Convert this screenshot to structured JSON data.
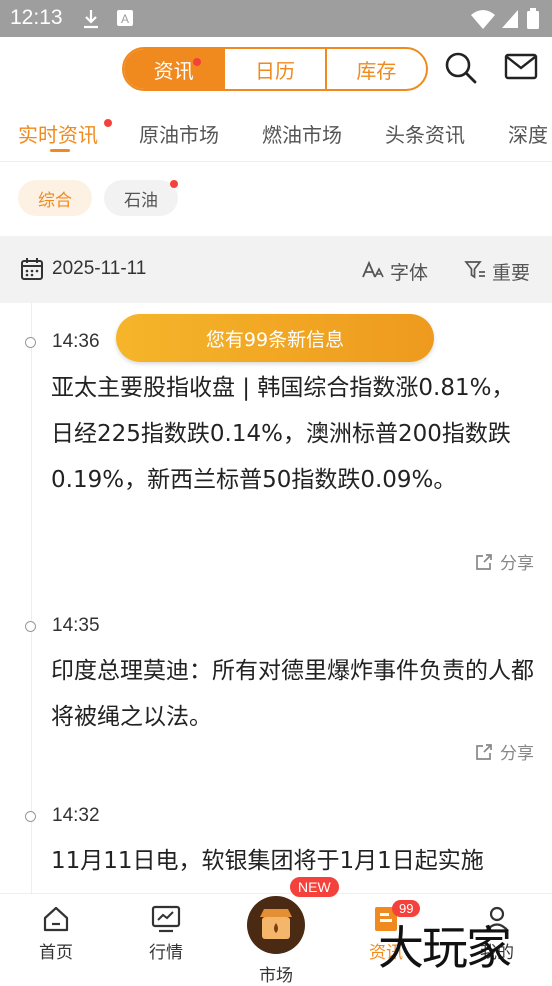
{
  "status_bar": {
    "time": "12:13"
  },
  "header": {
    "segments": [
      "资讯",
      "日历",
      "库存"
    ],
    "active_segment": "资讯"
  },
  "tabs": [
    "实时资讯",
    "原油市场",
    "燃油市场",
    "头条资讯",
    "深度"
  ],
  "chips": [
    "综合",
    "石油"
  ],
  "date_bar": {
    "date": "2025-11-11",
    "font_label": "字体",
    "important_label": "重要"
  },
  "toast": "您有99条新信息",
  "news": [
    {
      "time": "14:36",
      "text": "亚太主要股指收盘 | 韩国综合指数涨0.81%，日经225指数跌0.14%，澳洲标普200指数跌0.19%，新西兰标普50指数跌0.09%。",
      "share": "分享"
    },
    {
      "time": "14:35",
      "text": "印度总理莫迪：所有对德里爆炸事件负责的人都将被绳之以法。",
      "share": "分享"
    },
    {
      "time": "14:32",
      "text": "11月11日电，软银集团将于1月1日起实施",
      "share": ""
    }
  ],
  "bottom_nav": {
    "items": [
      "首页",
      "行情",
      "市场",
      "资讯",
      "我的"
    ],
    "market_badge": "NEW",
    "news_badge": "99"
  },
  "watermark": "大玩家",
  "colors": {
    "accent": "#f08a1e",
    "red": "#f5413b"
  }
}
